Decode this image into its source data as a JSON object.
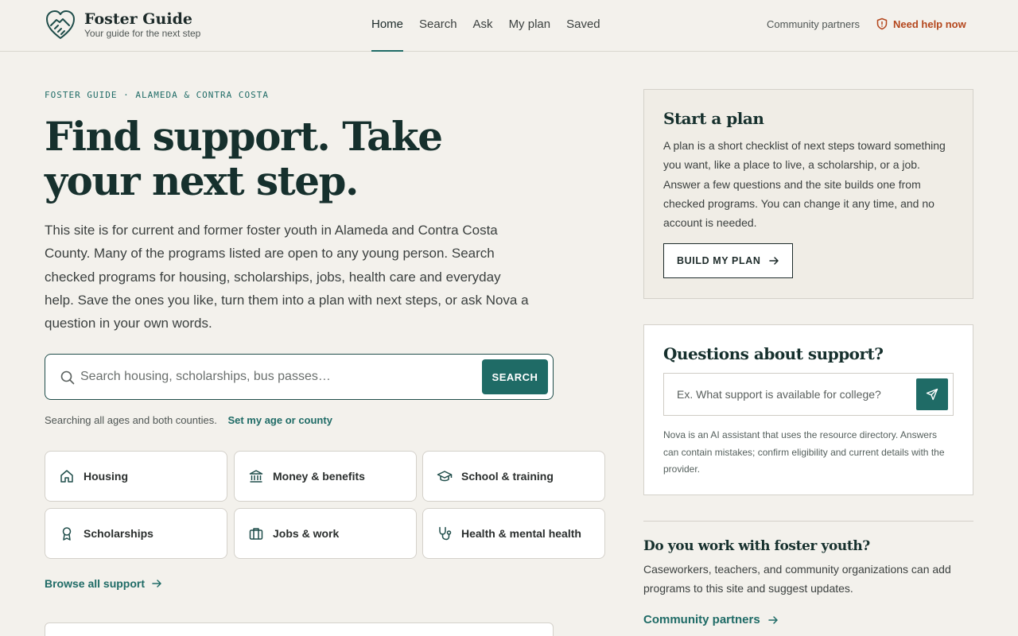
{
  "header": {
    "brand_name": "Foster Guide",
    "brand_tagline": "Your guide for the next step",
    "nav": [
      {
        "label": "Home",
        "active": true
      },
      {
        "label": "Search",
        "active": false
      },
      {
        "label": "Ask",
        "active": false
      },
      {
        "label": "My plan",
        "active": false
      },
      {
        "label": "Saved",
        "active": false
      }
    ],
    "partners_link": "Community partners",
    "help_link": "Need help now"
  },
  "hero": {
    "eyebrow": "FOSTER GUIDE · ALAMEDA & CONTRA COSTA",
    "title": "Find support. Take your next step.",
    "intro": "This site is for current and former foster youth in Alameda and Contra Costa County. Many of the programs listed are open to any young person. Search checked programs for housing, scholarships, jobs, health care and everyday help. Save the ones you like, turn them into a plan with next steps, or ask Nova a question in your own words."
  },
  "search": {
    "placeholder": "Search housing, scholarships, bus passes…",
    "value": "",
    "button_label": "SEARCH",
    "scope_text": "Searching all ages and both counties.",
    "scope_link": "Set my age or county"
  },
  "categories": [
    {
      "label": "Housing",
      "icon": "home-icon"
    },
    {
      "label": "Money & benefits",
      "icon": "bank-icon"
    },
    {
      "label": "School & training",
      "icon": "graduation-cap-icon"
    },
    {
      "label": "Scholarships",
      "icon": "award-icon"
    },
    {
      "label": "Jobs & work",
      "icon": "briefcase-icon"
    },
    {
      "label": "Health & mental health",
      "icon": "stethoscope-icon"
    }
  ],
  "browse_link": "Browse all support",
  "plan_card": {
    "title": "Start a plan",
    "description": "A plan is a short checklist of next steps toward something you want, like a place to live, a scholarship, or a job. Answer a few questions and the site builds one from checked programs. You can change it any time, and no account is needed.",
    "button_label": "BUILD MY PLAN"
  },
  "ask_card": {
    "title": "Questions about support?",
    "placeholder": "Ex. What support is available for college?",
    "value": "",
    "note": "Nova is an AI assistant that uses the resource directory. Answers can contain mistakes; confirm eligibility and current details with the provider."
  },
  "partners_section": {
    "title": "Do you work with foster youth?",
    "description": "Caseworkers, teachers, and community organizations can add programs to this site and suggest updates.",
    "link": "Community partners"
  },
  "colors": {
    "accent": "#1f6b66",
    "heading": "#16302d",
    "alert": "#b4471d",
    "background": "#f3f1ec"
  }
}
